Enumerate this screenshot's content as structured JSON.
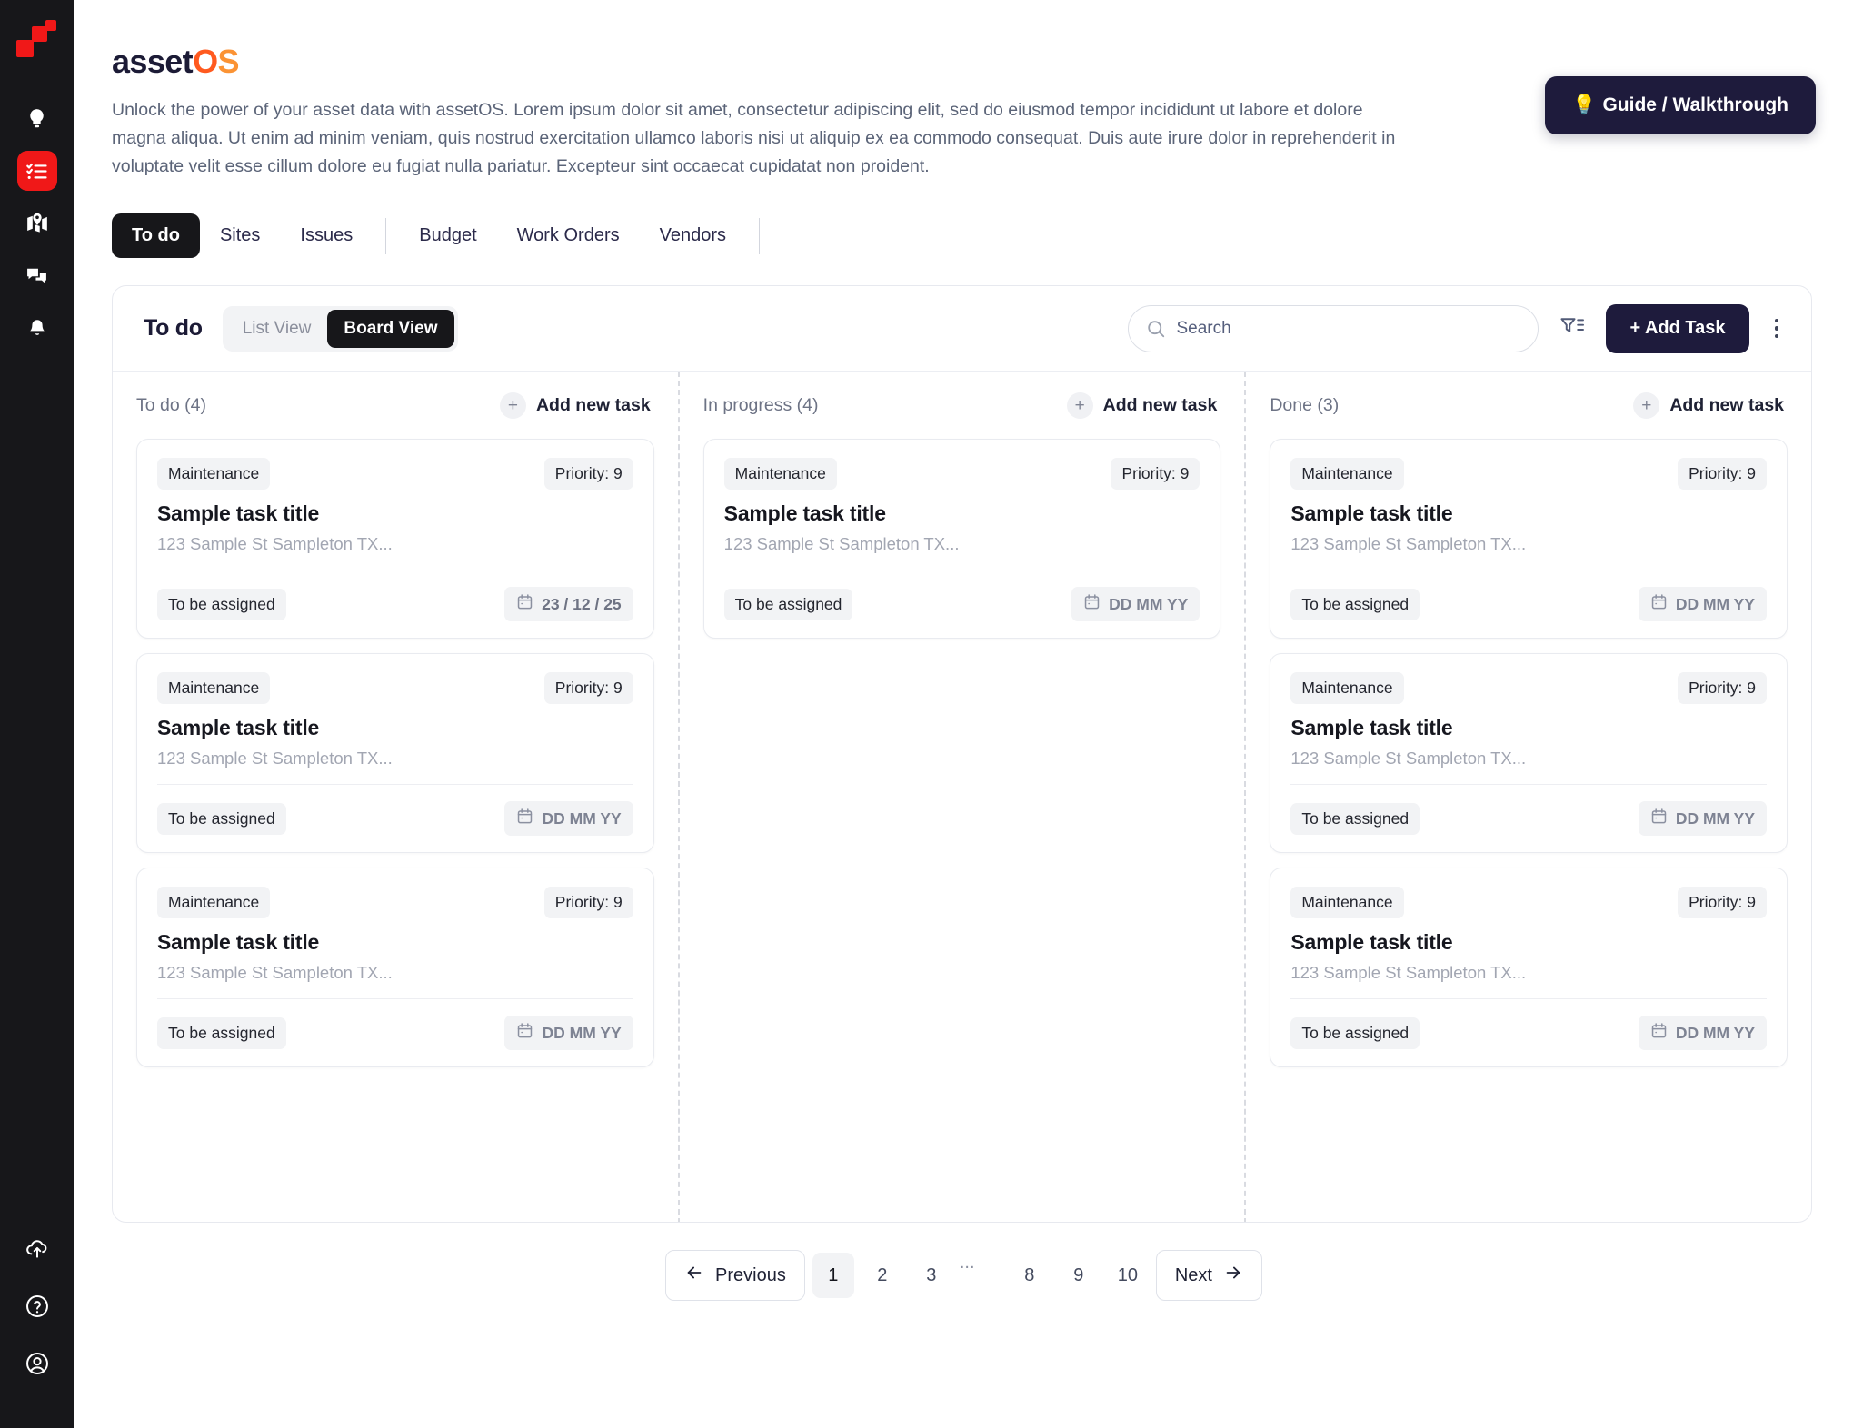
{
  "brand": {
    "part1": "asset",
    "part2": "O",
    "part3": "S"
  },
  "lede": "Unlock the power of your asset data with assetOS. Lorem ipsum dolor sit amet, consectetur adipiscing elit, sed do eiusmod tempor incididunt ut labore et dolore magna aliqua. Ut enim ad minim veniam, quis nostrud exercitation ullamco laboris nisi ut aliquip ex ea commodo consequat. Duis aute irure dolor in reprehenderit in voluptate velit esse cillum dolore eu fugiat nulla pariatur. Excepteur sint occaecat cupidatat non proident.",
  "guide_button": {
    "label": "Guide / Walkthrough",
    "icon": "lightbulb-emoji"
  },
  "rail": {
    "top_items": [
      {
        "name": "lightbulb-icon",
        "active": false
      },
      {
        "name": "checklist-icon",
        "active": true
      },
      {
        "name": "map-pin-icon",
        "active": false
      },
      {
        "name": "chat-bubbles-icon",
        "active": false
      },
      {
        "name": "bell-icon",
        "active": false
      }
    ],
    "bottom_items": [
      {
        "name": "cloud-upload-icon"
      },
      {
        "name": "help-circle-icon"
      },
      {
        "name": "user-account-icon"
      }
    ]
  },
  "tabs": [
    {
      "label": "To do",
      "active": true
    },
    {
      "label": "Sites",
      "active": false
    },
    {
      "label": "Issues",
      "active": false
    },
    {
      "divider": true
    },
    {
      "label": "Budget",
      "active": false
    },
    {
      "label": "Work Orders",
      "active": false
    },
    {
      "label": "Vendors",
      "active": false
    },
    {
      "divider": true
    }
  ],
  "toolbar": {
    "title": "To do",
    "view_list": "List View",
    "view_board": "Board View",
    "active_view": "Board View",
    "search_placeholder": "Search",
    "search_value": "",
    "filter_icon": "filter-funnel-icon",
    "add_task_label": "+ Add  Task",
    "more_icon": "more-vertical-icon"
  },
  "columns": [
    {
      "header": "To do (4)",
      "add_new_label": "Add new task",
      "cards": [
        {
          "tag": "Maintenance",
          "priority": "Priority: 9",
          "title": "Sample task title",
          "address": "123 Sample St Sampleton TX...",
          "assignee": "To be assigned",
          "date": "23 / 12 / 25"
        },
        {
          "tag": "Maintenance",
          "priority": "Priority: 9",
          "title": "Sample task title",
          "address": "123 Sample St Sampleton TX...",
          "assignee": "To be assigned",
          "date": "DD MM YY"
        },
        {
          "tag": "Maintenance",
          "priority": "Priority: 9",
          "title": "Sample task title",
          "address": "123 Sample St Sampleton TX...",
          "assignee": "To be assigned",
          "date": "DD MM YY"
        }
      ]
    },
    {
      "header": "In progress (4)",
      "add_new_label": "Add new task",
      "cards": [
        {
          "tag": "Maintenance",
          "priority": "Priority: 9",
          "title": "Sample task title",
          "address": "123 Sample St Sampleton TX...",
          "assignee": "To be assigned",
          "date": "DD MM YY"
        }
      ]
    },
    {
      "header": "Done (3)",
      "add_new_label": "Add new task",
      "cards": [
        {
          "tag": "Maintenance",
          "priority": "Priority: 9",
          "title": "Sample task title",
          "address": "123 Sample St Sampleton TX...",
          "assignee": "To be assigned",
          "date": "DD MM YY"
        },
        {
          "tag": "Maintenance",
          "priority": "Priority: 9",
          "title": "Sample task title",
          "address": "123 Sample St Sampleton TX...",
          "assignee": "To be assigned",
          "date": "DD MM YY"
        },
        {
          "tag": "Maintenance",
          "priority": "Priority: 9",
          "title": "Sample task title",
          "address": "123 Sample St Sampleton TX...",
          "assignee": "To be assigned",
          "date": "DD MM YY"
        }
      ]
    }
  ],
  "pagination": {
    "previous": "Previous",
    "next": "Next",
    "pages": [
      "1",
      "2",
      "3",
      "...",
      "8",
      "9",
      "10"
    ],
    "current": "1"
  },
  "colors": {
    "accent_red": "#f01818",
    "brand_orange": "#ff5a1f",
    "dark_navy": "#1e1b3c",
    "rail_bg": "#17171a"
  }
}
